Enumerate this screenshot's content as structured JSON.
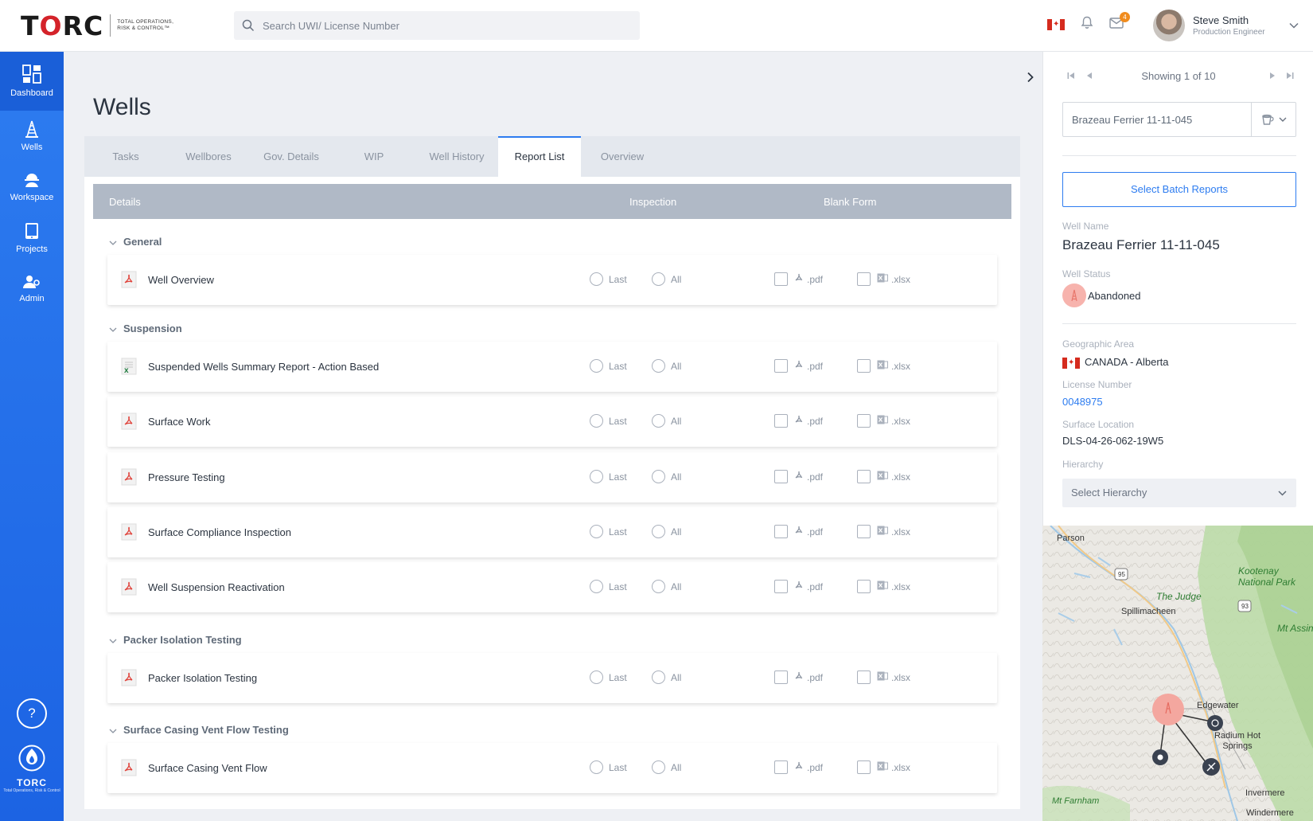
{
  "brand": {
    "name": "TORC",
    "tagline": "TOTAL OPERATIONS, RISK & CONTROL",
    "trademark": "™",
    "accent": "#2d7cf0",
    "logo_red": "#d4232a"
  },
  "search": {
    "placeholder": "Search UWI/ License Number"
  },
  "header": {
    "notifications_badge": "4",
    "user_name": "Steve Smith",
    "user_role": "Production Engineer"
  },
  "nav": {
    "items": [
      {
        "label": "Dashboard",
        "icon": "dashboard-icon"
      },
      {
        "label": "Wells",
        "icon": "oil-derrick-icon"
      },
      {
        "label": "Workspace",
        "icon": "worker-helmet-icon"
      },
      {
        "label": "Projects",
        "icon": "tablet-icon"
      },
      {
        "label": "Admin",
        "icon": "admin-user-icon"
      }
    ],
    "help": "?",
    "logo_word": "TORC",
    "logo_sub": "Total Operations, Risk & Control"
  },
  "page": {
    "title": "Wells"
  },
  "tabs": [
    "Tasks",
    "Wellbores",
    "Gov. Details",
    "WIP",
    "Well History",
    "Report List",
    "Overview"
  ],
  "active_tab": "Report List",
  "table": {
    "col_details": "Details",
    "col_inspection": "Inspection",
    "col_blank": "Blank Form",
    "opt_last": "Last",
    "opt_all": "All",
    "opt_pdf": ".pdf",
    "opt_xlsx": ".xlsx",
    "sections": [
      {
        "title": "General",
        "rows": [
          {
            "name": "Well Overview",
            "type": "pdf"
          }
        ]
      },
      {
        "title": "Suspension",
        "rows": [
          {
            "name": "Suspended Wells Summary Report - Action Based",
            "type": "xlsx"
          },
          {
            "name": "Surface Work",
            "type": "pdf"
          },
          {
            "name": "Pressure Testing",
            "type": "pdf"
          },
          {
            "name": "Surface Compliance Inspection",
            "type": "pdf"
          },
          {
            "name": "Well Suspension Reactivation",
            "type": "pdf"
          }
        ]
      },
      {
        "title": "Packer Isolation Testing",
        "rows": [
          {
            "name": "Packer Isolation Testing",
            "type": "pdf"
          }
        ]
      },
      {
        "title": "Surface Casing Vent Flow Testing",
        "rows": [
          {
            "name": "Surface Casing Vent Flow",
            "type": "pdf"
          }
        ]
      }
    ]
  },
  "right": {
    "pager_text": "Showing 1 of 10",
    "well_select_value": "Brazeau Ferrier 11-11-045",
    "batch_button": "Select Batch Reports",
    "well_name_label": "Well Name",
    "well_name": "Brazeau Ferrier 11-11-045",
    "well_status_label": "Well Status",
    "well_status": "Abandoned",
    "status_color": "#f7b3ad",
    "geo_label": "Geographic Area",
    "geo_value": "CANADA - Alberta",
    "license_label": "License Number",
    "license_value": "0048975",
    "surface_label": "Surface Location",
    "surface_value": "DLS-04-26-062-19W5",
    "hierarchy_label": "Hierarchy",
    "hierarchy_placeholder": "Select Hierarchy"
  },
  "map": {
    "labels": [
      "Parson",
      "The Judge",
      "Spillimacheen",
      "Kootenay National Park",
      "Mt Assiniboine",
      "Edgewater",
      "Radium Hot Springs",
      "Mt Farnham",
      "Invermere",
      "Windermere"
    ],
    "road_95": "95",
    "road_93": "93"
  }
}
